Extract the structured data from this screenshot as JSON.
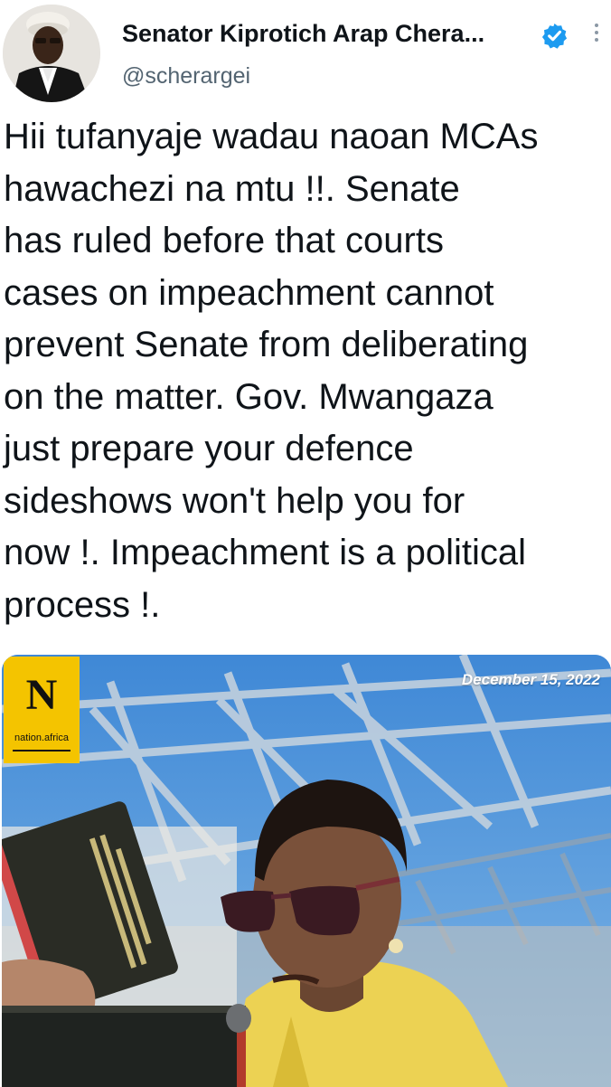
{
  "author": {
    "name": "Senator Kiprotich Arap Chera...",
    "handle": "@scherargei",
    "avatar_icon": "user-avatar",
    "verified_icon": "verified-badge-icon",
    "verified_color": "#1d9bf0"
  },
  "tweet": {
    "text": "Hii tufanyaje wadau naoan MCAs\nhawachezi na mtu !!. Senate\nhas ruled before that courts\ncases on impeachment cannot\nprevent Senate from deliberating\non the matter. Gov. Mwangaza\njust prepare your defence\nsideshows won't help you for\nnow !. Impeachment is a political\nprocess !."
  },
  "media": {
    "logo_letter": "N",
    "logo_text": "nation.africa",
    "logo_color": "#f4c400",
    "date": "December 15, 2022"
  }
}
